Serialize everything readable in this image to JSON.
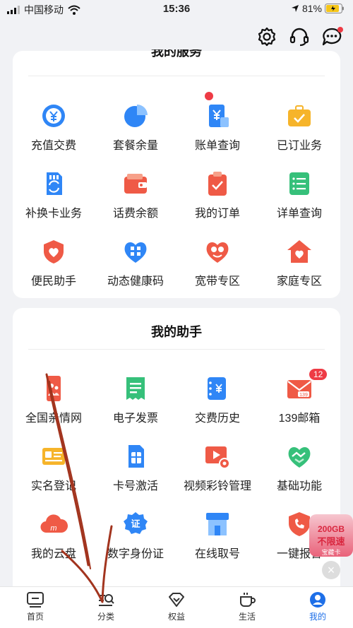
{
  "status_bar": {
    "carrier": "中国移动",
    "time": "15:36",
    "battery": "81%"
  },
  "top_actions": {
    "settings_icon": "gear-icon",
    "service_icon": "headset-icon",
    "message_icon": "chat-bubble-icon"
  },
  "services": {
    "title": "我的服务",
    "items": [
      {
        "label": "充值交费",
        "icon": "yuan-refresh-icon",
        "color": "#2f86f6"
      },
      {
        "label": "套餐余量",
        "icon": "pie-chart-icon",
        "color": "#2f86f6"
      },
      {
        "label": "账单查询",
        "icon": "bill-icon",
        "color": "#2f86f6"
      },
      {
        "label": "已订业务",
        "icon": "briefcase-icon",
        "color": "#f6b42a"
      },
      {
        "label": "补换卡业务",
        "icon": "sim-refresh-icon",
        "color": "#2f86f6"
      },
      {
        "label": "话费余额",
        "icon": "wallet-icon",
        "color": "#ef5a46"
      },
      {
        "label": "我的订单",
        "icon": "clipboard-check-icon",
        "color": "#ef5a46"
      },
      {
        "label": "详单查询",
        "icon": "list-icon",
        "color": "#36c07a"
      },
      {
        "label": "便民助手",
        "icon": "hands-heart-icon",
        "color": "#ef5a46"
      },
      {
        "label": "动态健康码",
        "icon": "qr-heart-icon",
        "color": "#2f86f6"
      },
      {
        "label": "宽带专区",
        "icon": "heart-face-icon",
        "color": "#ef5a46"
      },
      {
        "label": "家庭专区",
        "icon": "house-heart-icon",
        "color": "#ef5a46"
      }
    ]
  },
  "assistant": {
    "title": "我的助手",
    "items": [
      {
        "label": "全国亲情网",
        "icon": "family-phone-icon",
        "color": "#ef5a46"
      },
      {
        "label": "电子发票",
        "icon": "receipt-icon",
        "color": "#36c07a"
      },
      {
        "label": "交费历史",
        "icon": "history-card-icon",
        "color": "#2f86f6"
      },
      {
        "label": "139邮箱",
        "icon": "mail-139-icon",
        "color": "#ef5a46",
        "badge": "12"
      },
      {
        "label": "实名登记",
        "icon": "id-card-icon",
        "color": "#f6b42a"
      },
      {
        "label": "卡号激活",
        "icon": "sim-card-icon",
        "color": "#2f86f6"
      },
      {
        "label": "视频彩铃管理",
        "icon": "video-ring-icon",
        "color": "#ef5a46"
      },
      {
        "label": "基础功能",
        "icon": "handshake-heart-icon",
        "color": "#36c07a"
      },
      {
        "label": "我的云盘",
        "icon": "cloud-icon",
        "color": "#ef5a46"
      },
      {
        "label": "数字身份证",
        "icon": "cert-badge-icon",
        "color": "#2f86f6"
      },
      {
        "label": "在线取号",
        "icon": "store-icon",
        "color": "#2f86f6"
      },
      {
        "label": "一键报警",
        "icon": "shield-phone-icon",
        "color": "#ef5a46"
      }
    ]
  },
  "float_ad": {
    "line1": "200GB",
    "line2": "不限速",
    "line3": "宝藏卡"
  },
  "tab_bar": {
    "tabs": [
      {
        "label": "首页",
        "icon": "home-tab-icon"
      },
      {
        "label": "分类",
        "icon": "category-tab-icon"
      },
      {
        "label": "权益",
        "icon": "diamond-tab-icon"
      },
      {
        "label": "生活",
        "icon": "cup-tab-icon"
      },
      {
        "label": "我的",
        "icon": "profile-tab-icon"
      }
    ],
    "active": "我的"
  }
}
